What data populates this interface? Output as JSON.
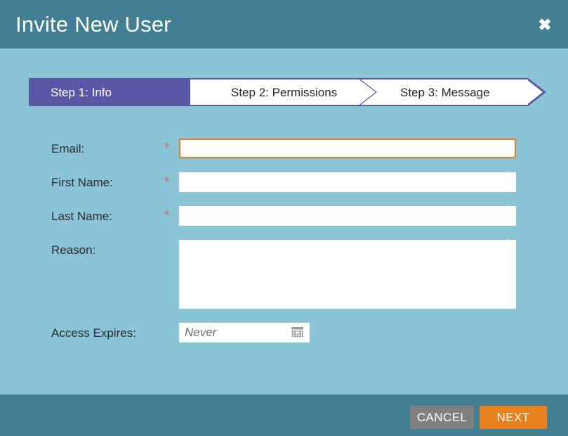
{
  "dialog": {
    "title": "Invite New User",
    "close_icon": "close-icon",
    "close_glyph": "✖"
  },
  "stepper": {
    "steps": [
      {
        "label": "Step 1: Info",
        "active": true
      },
      {
        "label": "Step 2: Permissions",
        "active": false
      },
      {
        "label": "Step 3: Message",
        "active": false
      }
    ],
    "active_color": "#5b56a6",
    "inactive_bg": "#ffffff"
  },
  "form": {
    "required_marker": "*",
    "fields": [
      {
        "label": "Email:",
        "required": true,
        "value": "",
        "placeholder": "",
        "type": "text",
        "focused": true
      },
      {
        "label": "First Name:",
        "required": true,
        "value": "",
        "placeholder": "",
        "type": "text",
        "focused": false
      },
      {
        "label": "Last Name:",
        "required": true,
        "value": "",
        "placeholder": "",
        "type": "text",
        "focused": false
      },
      {
        "label": "Reason:",
        "required": false,
        "value": "",
        "placeholder": "",
        "type": "textarea",
        "focused": false
      },
      {
        "label": "Access Expires:",
        "required": false,
        "value": "",
        "placeholder": "Never",
        "type": "date",
        "focused": false,
        "icon": "calendar-icon"
      }
    ]
  },
  "footer": {
    "cancel_label": "CANCEL",
    "next_label": "NEXT",
    "cancel_color": "#808080",
    "next_color": "#e8821e"
  },
  "colors": {
    "header_bg": "#437f92",
    "body_bg": "#8ac4d6",
    "accent_purple": "#5b56a6",
    "accent_orange": "#e8821e",
    "required_star": "#cc7070"
  }
}
